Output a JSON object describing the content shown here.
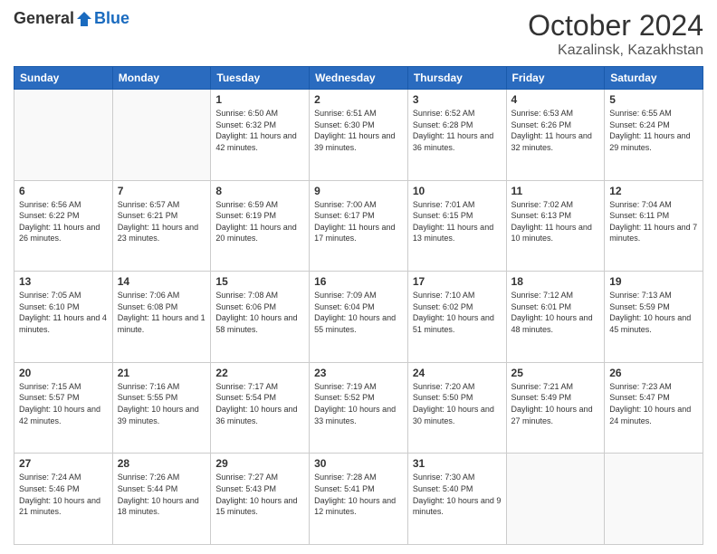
{
  "header": {
    "logo_general": "General",
    "logo_blue": "Blue",
    "month_title": "October 2024",
    "location": "Kazalinsk, Kazakhstan"
  },
  "days_of_week": [
    "Sunday",
    "Monday",
    "Tuesday",
    "Wednesday",
    "Thursday",
    "Friday",
    "Saturday"
  ],
  "weeks": [
    [
      {
        "day": "",
        "empty": true
      },
      {
        "day": "",
        "empty": true
      },
      {
        "day": "1",
        "sunrise": "6:50 AM",
        "sunset": "6:32 PM",
        "daylight": "11 hours and 42 minutes."
      },
      {
        "day": "2",
        "sunrise": "6:51 AM",
        "sunset": "6:30 PM",
        "daylight": "11 hours and 39 minutes."
      },
      {
        "day": "3",
        "sunrise": "6:52 AM",
        "sunset": "6:28 PM",
        "daylight": "11 hours and 36 minutes."
      },
      {
        "day": "4",
        "sunrise": "6:53 AM",
        "sunset": "6:26 PM",
        "daylight": "11 hours and 32 minutes."
      },
      {
        "day": "5",
        "sunrise": "6:55 AM",
        "sunset": "6:24 PM",
        "daylight": "11 hours and 29 minutes."
      }
    ],
    [
      {
        "day": "6",
        "sunrise": "6:56 AM",
        "sunset": "6:22 PM",
        "daylight": "11 hours and 26 minutes."
      },
      {
        "day": "7",
        "sunrise": "6:57 AM",
        "sunset": "6:21 PM",
        "daylight": "11 hours and 23 minutes."
      },
      {
        "day": "8",
        "sunrise": "6:59 AM",
        "sunset": "6:19 PM",
        "daylight": "11 hours and 20 minutes."
      },
      {
        "day": "9",
        "sunrise": "7:00 AM",
        "sunset": "6:17 PM",
        "daylight": "11 hours and 17 minutes."
      },
      {
        "day": "10",
        "sunrise": "7:01 AM",
        "sunset": "6:15 PM",
        "daylight": "11 hours and 13 minutes."
      },
      {
        "day": "11",
        "sunrise": "7:02 AM",
        "sunset": "6:13 PM",
        "daylight": "11 hours and 10 minutes."
      },
      {
        "day": "12",
        "sunrise": "7:04 AM",
        "sunset": "6:11 PM",
        "daylight": "11 hours and 7 minutes."
      }
    ],
    [
      {
        "day": "13",
        "sunrise": "7:05 AM",
        "sunset": "6:10 PM",
        "daylight": "11 hours and 4 minutes."
      },
      {
        "day": "14",
        "sunrise": "7:06 AM",
        "sunset": "6:08 PM",
        "daylight": "11 hours and 1 minute."
      },
      {
        "day": "15",
        "sunrise": "7:08 AM",
        "sunset": "6:06 PM",
        "daylight": "10 hours and 58 minutes."
      },
      {
        "day": "16",
        "sunrise": "7:09 AM",
        "sunset": "6:04 PM",
        "daylight": "10 hours and 55 minutes."
      },
      {
        "day": "17",
        "sunrise": "7:10 AM",
        "sunset": "6:02 PM",
        "daylight": "10 hours and 51 minutes."
      },
      {
        "day": "18",
        "sunrise": "7:12 AM",
        "sunset": "6:01 PM",
        "daylight": "10 hours and 48 minutes."
      },
      {
        "day": "19",
        "sunrise": "7:13 AM",
        "sunset": "5:59 PM",
        "daylight": "10 hours and 45 minutes."
      }
    ],
    [
      {
        "day": "20",
        "sunrise": "7:15 AM",
        "sunset": "5:57 PM",
        "daylight": "10 hours and 42 minutes."
      },
      {
        "day": "21",
        "sunrise": "7:16 AM",
        "sunset": "5:55 PM",
        "daylight": "10 hours and 39 minutes."
      },
      {
        "day": "22",
        "sunrise": "7:17 AM",
        "sunset": "5:54 PM",
        "daylight": "10 hours and 36 minutes."
      },
      {
        "day": "23",
        "sunrise": "7:19 AM",
        "sunset": "5:52 PM",
        "daylight": "10 hours and 33 minutes."
      },
      {
        "day": "24",
        "sunrise": "7:20 AM",
        "sunset": "5:50 PM",
        "daylight": "10 hours and 30 minutes."
      },
      {
        "day": "25",
        "sunrise": "7:21 AM",
        "sunset": "5:49 PM",
        "daylight": "10 hours and 27 minutes."
      },
      {
        "day": "26",
        "sunrise": "7:23 AM",
        "sunset": "5:47 PM",
        "daylight": "10 hours and 24 minutes."
      }
    ],
    [
      {
        "day": "27",
        "sunrise": "7:24 AM",
        "sunset": "5:46 PM",
        "daylight": "10 hours and 21 minutes."
      },
      {
        "day": "28",
        "sunrise": "7:26 AM",
        "sunset": "5:44 PM",
        "daylight": "10 hours and 18 minutes."
      },
      {
        "day": "29",
        "sunrise": "7:27 AM",
        "sunset": "5:43 PM",
        "daylight": "10 hours and 15 minutes."
      },
      {
        "day": "30",
        "sunrise": "7:28 AM",
        "sunset": "5:41 PM",
        "daylight": "10 hours and 12 minutes."
      },
      {
        "day": "31",
        "sunrise": "7:30 AM",
        "sunset": "5:40 PM",
        "daylight": "10 hours and 9 minutes."
      },
      {
        "day": "",
        "empty": true
      },
      {
        "day": "",
        "empty": true
      }
    ]
  ]
}
